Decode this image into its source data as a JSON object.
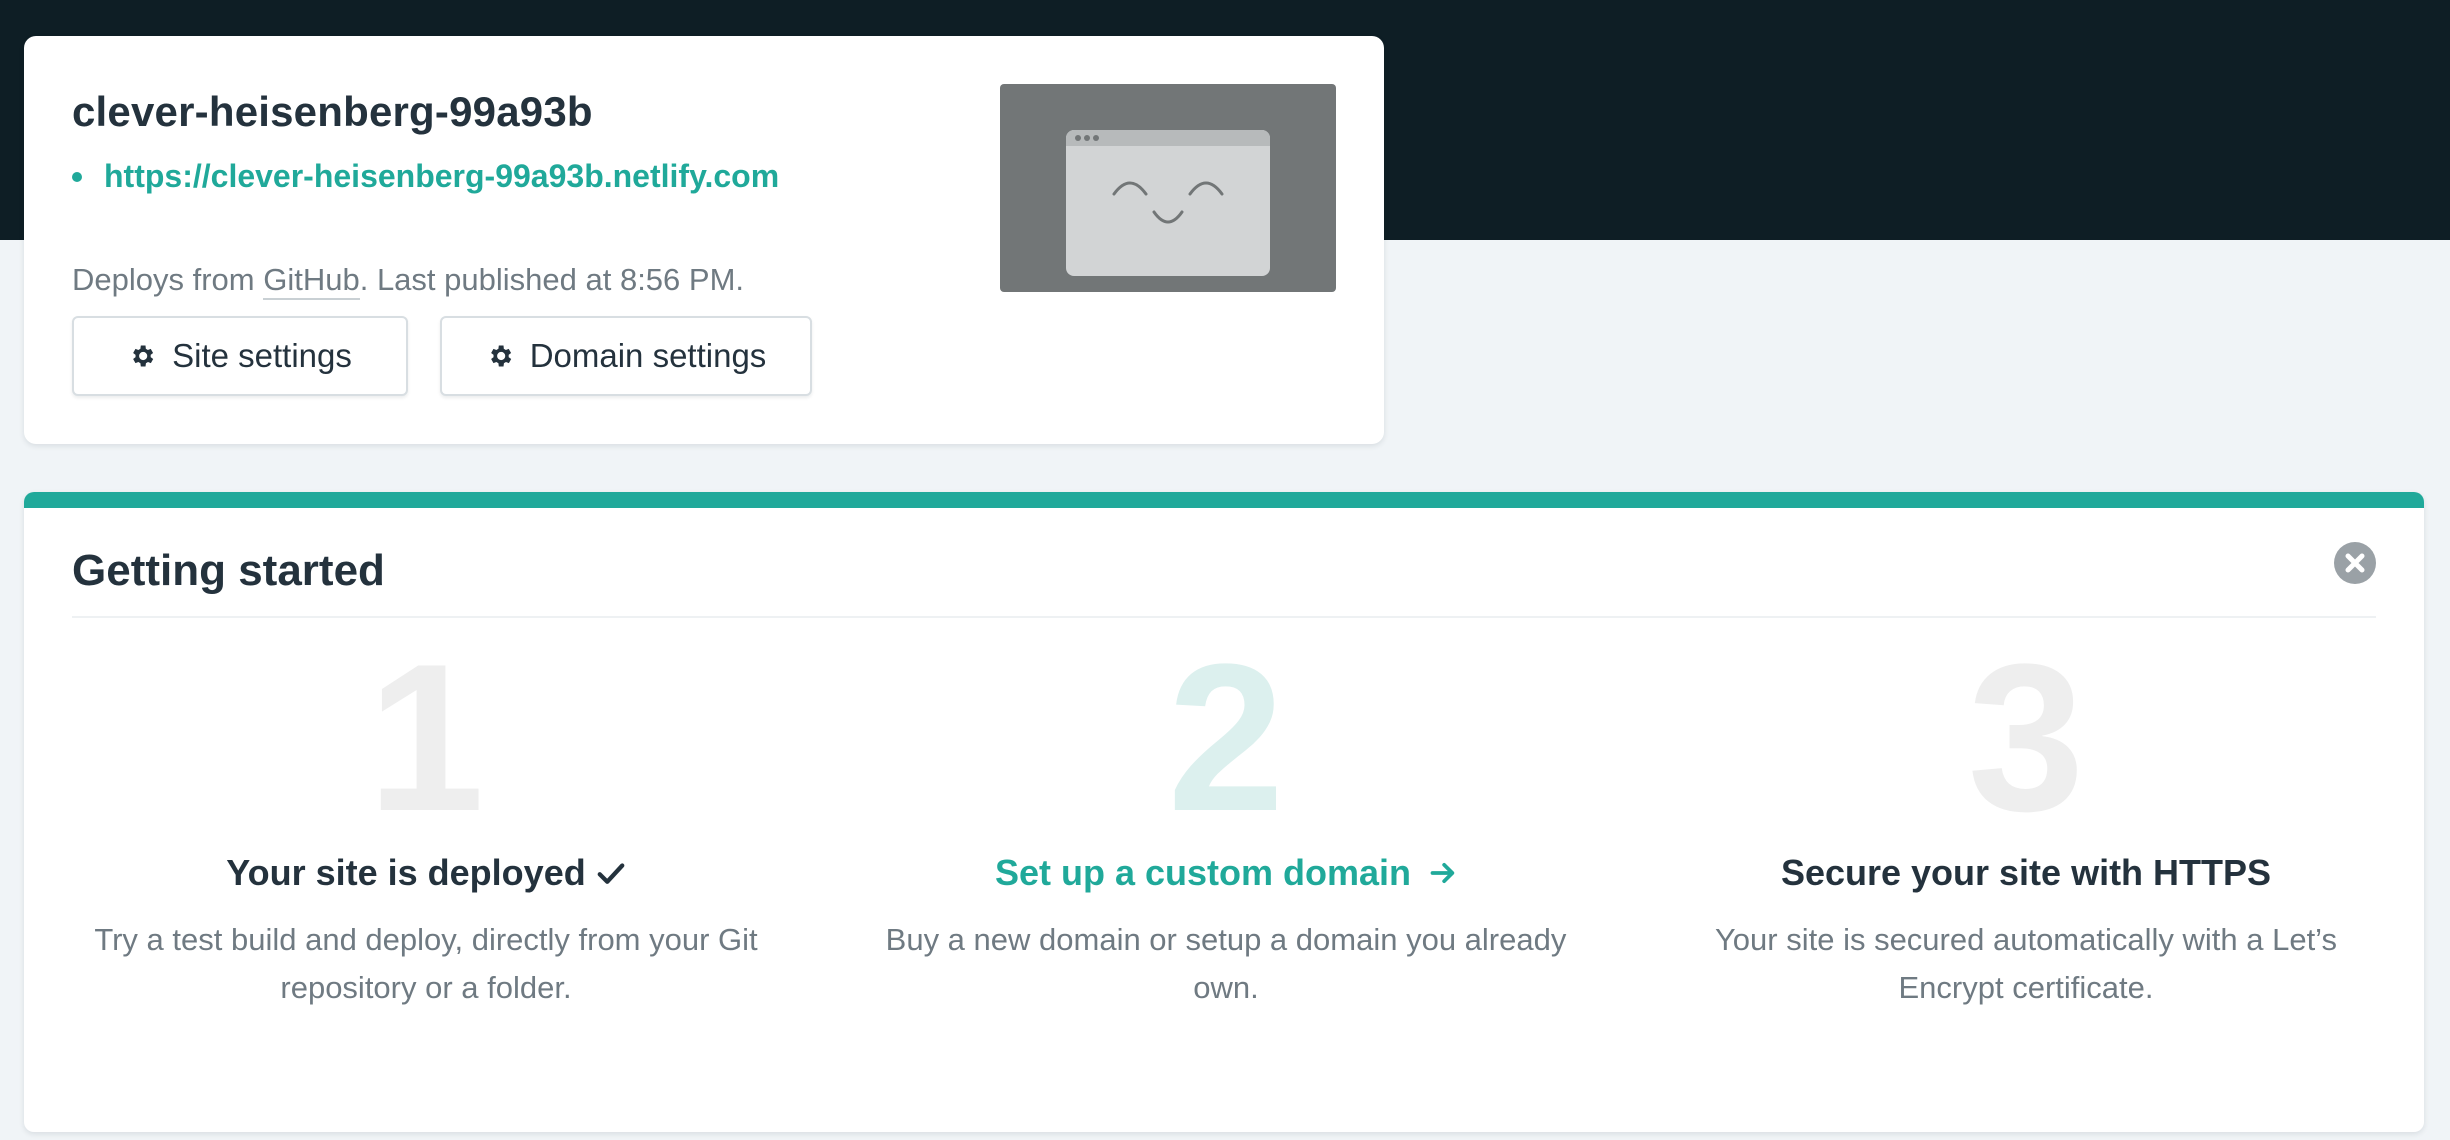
{
  "site": {
    "name": "clever-heisenberg-99a93b",
    "url": "https://clever-heisenberg-99a93b.netlify.com",
    "deploy_prefix": "Deploys from ",
    "deploy_source": "GitHub",
    "deploy_suffix": ". Last published at 8:56 PM.",
    "buttons": {
      "site_settings": "Site settings",
      "domain_settings": "Domain settings"
    },
    "preview_icon": "smiling-browser-window-icon"
  },
  "getting_started": {
    "title": "Getting started",
    "close_icon": "close-icon",
    "steps": [
      {
        "number": "1",
        "title": "Your site is deployed",
        "status_icon": "checkmark-icon",
        "description": "Try a test build and deploy, directly from your Git repository or a folder."
      },
      {
        "number": "2",
        "title": "Set up a custom domain",
        "status_icon": "arrow-right-icon",
        "description": "Buy a new domain or setup a domain you already own."
      },
      {
        "number": "3",
        "title": "Secure your site with HTTPS",
        "description": "Your site is secured automatically with a Let’s Encrypt certificate."
      }
    ]
  },
  "colors": {
    "accent": "#20a99a",
    "header_background": "#0e1e25",
    "page_background": "#f0f4f7",
    "text_primary": "#24323d",
    "text_muted": "#6f7a82"
  }
}
